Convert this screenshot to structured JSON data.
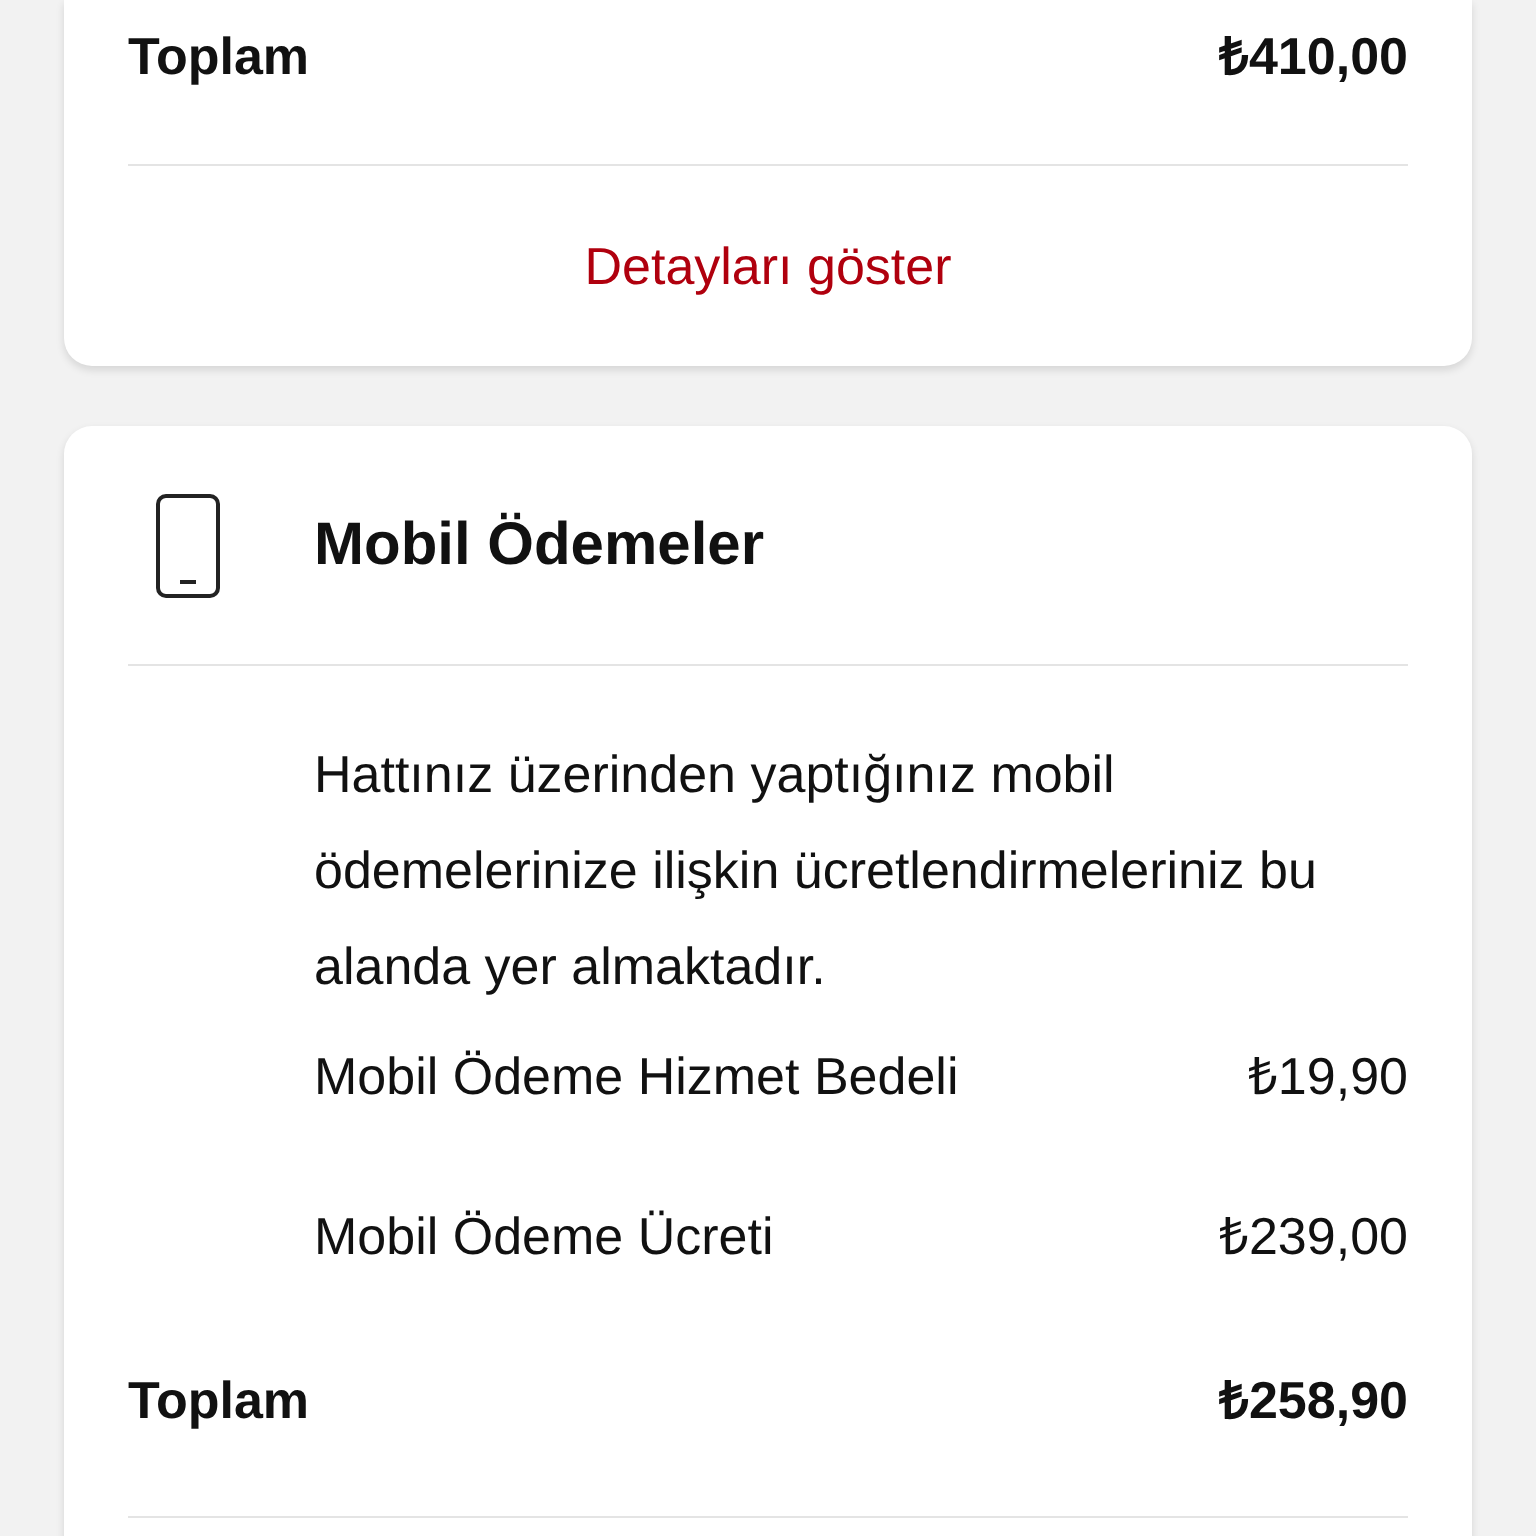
{
  "summary_card": {
    "total": {
      "label": "Toplam",
      "amount": "₺410,00"
    },
    "details_link": "Detayları göster"
  },
  "mobile_payments_card": {
    "title": "Mobil Ödemeler",
    "description": "Hattınız üzerinden yaptığınız mobil ödemelerinize ilişkin ücretlendirmeleriniz bu alanda yer almaktadır.",
    "items": [
      {
        "label": "Mobil Ödeme Hizmet Bedeli",
        "amount": "₺19,90"
      },
      {
        "label": "Mobil Ödeme Ücreti",
        "amount": "₺239,00"
      }
    ],
    "total": {
      "label": "Toplam",
      "amount": "₺258,90"
    }
  }
}
